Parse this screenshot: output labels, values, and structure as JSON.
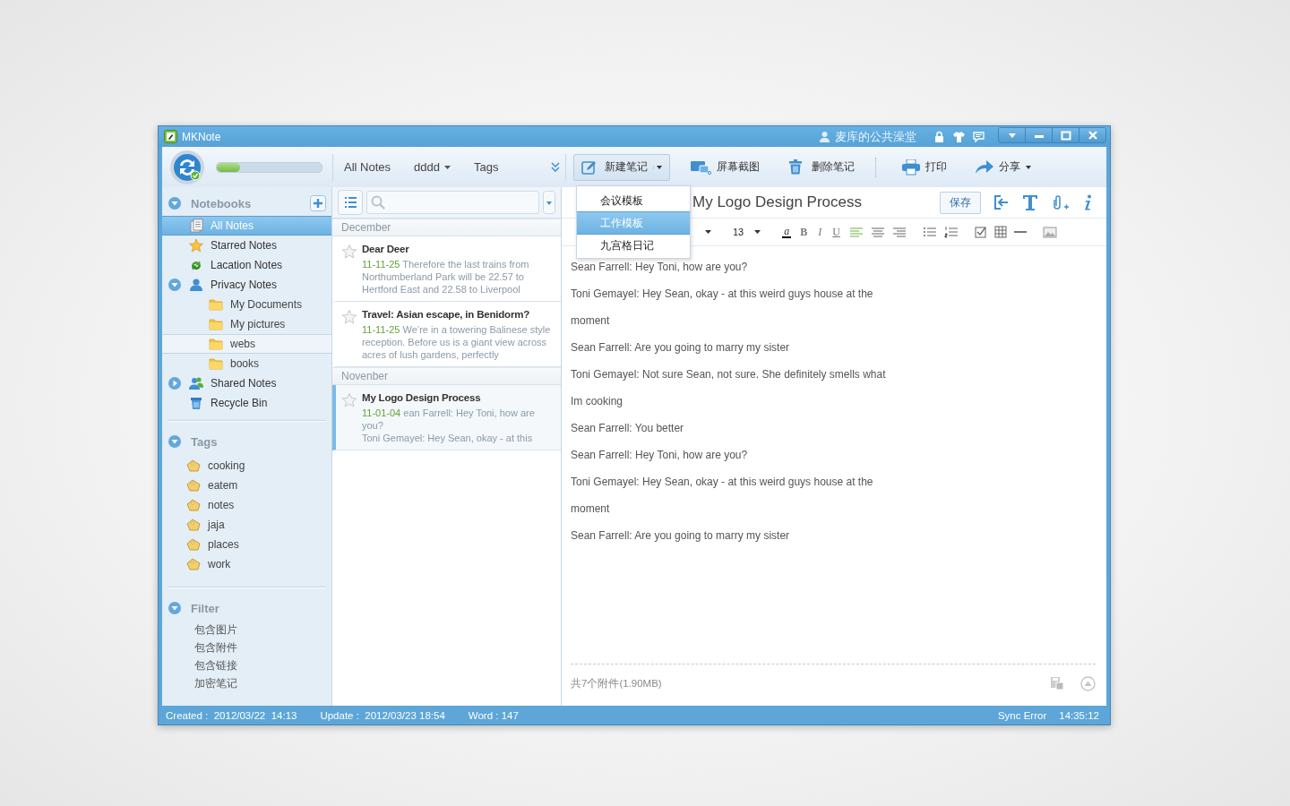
{
  "window": {
    "title": "MKNote",
    "user": "麦库的公共澡堂"
  },
  "sync": {
    "level": 0.22
  },
  "nav_tabs": [
    {
      "label": "All Notes",
      "kind": "plain"
    },
    {
      "label": "dddd",
      "kind": "dropdown"
    },
    {
      "label": "Tags",
      "kind": "plain"
    }
  ],
  "toolbar": [
    {
      "label": "新建笔记",
      "kind": "new",
      "pressed": true,
      "menu": true
    },
    {
      "label": "屏幕截图",
      "kind": "capture",
      "pressed": false,
      "menu": false
    },
    {
      "label": "删除笔记",
      "kind": "delete",
      "pressed": false,
      "menu": false
    },
    {
      "label": "打印",
      "kind": "print",
      "pressed": false,
      "menu": false
    },
    {
      "label": "分享",
      "kind": "share",
      "pressed": false,
      "menu": true
    }
  ],
  "template_menu": [
    {
      "label": "会议模板",
      "selected": false
    },
    {
      "label": "工作模板",
      "selected": true
    },
    {
      "label": "九宫格日记",
      "selected": false
    }
  ],
  "sidebar": {
    "notebooks": {
      "title": "Notebooks",
      "expanded": true,
      "items": [
        {
          "label": "All Notes",
          "kind": "all",
          "selected": true,
          "hovered": false
        },
        {
          "label": "Starred Notes",
          "kind": "star",
          "selected": false,
          "hovered": false
        },
        {
          "label": "Lacation Notes",
          "kind": "location",
          "selected": false,
          "hovered": false
        },
        {
          "label": "Privacy Notes",
          "kind": "privacy",
          "selected": false,
          "hovered": false,
          "expanded": true,
          "children": [
            {
              "label": "My Documents",
              "kind": "folder",
              "selected": false,
              "hovered": false
            },
            {
              "label": "My pictures",
              "kind": "folder",
              "selected": false,
              "hovered": false
            },
            {
              "label": "webs",
              "kind": "folder",
              "selected": false,
              "hovered": true
            },
            {
              "label": "books",
              "kind": "folder",
              "selected": false,
              "hovered": false
            }
          ]
        },
        {
          "label": "Shared Notes",
          "kind": "shared",
          "selected": false,
          "hovered": false,
          "expanded": false
        },
        {
          "label": "Recycle Bin",
          "kind": "trash",
          "selected": false,
          "hovered": false
        }
      ]
    },
    "tags": {
      "title": "Tags",
      "expanded": true,
      "items": [
        "cooking",
        "eatem",
        "notes",
        "jaja",
        "places",
        "work"
      ]
    },
    "filter": {
      "title": "Filter",
      "expanded": true,
      "items": [
        "包含图片",
        "包含附件",
        "包含链接",
        "加密笔记"
      ]
    }
  },
  "note_list": [
    {
      "month": "December",
      "notes": [
        {
          "title": "Dear Deer",
          "starred": false,
          "selected": false,
          "date": "11-11-25",
          "snippet": "Therefore the last trains from Northumberland Park will be 22.57 to Hertford East and 22.58 to Liverpool"
        },
        {
          "title": "Travel: Asian escape, in Benidorm?",
          "starred": false,
          "selected": false,
          "date": "11-11-25",
          "snippet": "We’re in a towering Balinese style reception. Before us is a giant view across acres of lush gardens, perfectly"
        }
      ]
    },
    {
      "month": "Novenber",
      "notes": [
        {
          "title": "My  Logo Design Process",
          "starred": false,
          "selected": true,
          "date": "11-01-04",
          "snippet": "ean Farrell:  Hey Toni, how are you?\nToni Gemayel:  Hey Sean, okay - at this"
        }
      ]
    }
  ],
  "editor": {
    "title": "My Logo Design Process",
    "save": "保存",
    "format": [
      {
        "kind": "caret"
      },
      {
        "kind": "size",
        "label": "13"
      },
      {
        "kind": "color",
        "label": "a"
      },
      {
        "kind": "bold",
        "label": "B"
      },
      {
        "kind": "italic",
        "label": "I"
      },
      {
        "kind": "underline",
        "label": "U"
      },
      {
        "kind": "align-left",
        "selected": true
      },
      {
        "kind": "align-center",
        "selected": false
      },
      {
        "kind": "align-right",
        "selected": false
      },
      {
        "kind": "bullets"
      },
      {
        "kind": "numbers"
      },
      {
        "kind": "checkbox"
      },
      {
        "kind": "table"
      },
      {
        "kind": "rule"
      },
      {
        "kind": "image"
      }
    ],
    "lines": [
      "Sean Farrell:  Hey Toni, how are you?",
      "Toni Gemayel:  Hey Sean, okay - at this weird guys house at the",
      "moment",
      "Sean Farrell:  Are you going to marry my sister",
      "Toni Gemayel:  Not sure Sean, not sure.  She definitely smells what",
      "Im cooking",
      "Sean Farrell:  You better",
      "Sean Farrell:  Hey Toni, how are you?",
      "Toni Gemayel:  Hey Sean, okay - at this weird guys house at the",
      "moment",
      "Sean Farrell:  Are you going to marry my sister"
    ],
    "attachments": "共7个附件(1.90MB)"
  },
  "status_bar": {
    "created": "Created :  2012/03/22  14:13",
    "updated": "Update :  2012/03/23 18:54",
    "words": "Word : 147",
    "sync": "Sync Error",
    "time": "14:35:12"
  }
}
